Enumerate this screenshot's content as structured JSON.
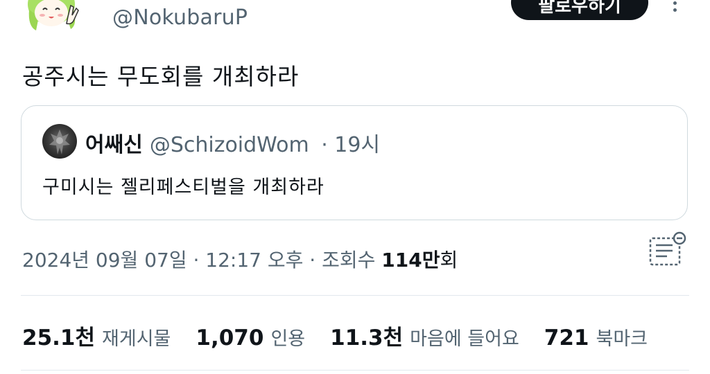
{
  "header": {
    "handle": "@NokubaruP",
    "follow_label": "팔로우하기"
  },
  "tweet": {
    "text": "공주시는 무도회를 개최하라"
  },
  "quote": {
    "name": "어쌔신",
    "handle": "@SchizoidWom",
    "time": "· 19시",
    "text": "구미시는 젤리페스티벌을 개최하라"
  },
  "meta": {
    "datetime": "2024년 09월 07일 · 12:17 오후 · 조회수 ",
    "views_number": "114만",
    "views_unit": "회"
  },
  "stats": [
    {
      "value": "25.1천",
      "label": "재게시물"
    },
    {
      "value": "1,070",
      "label": "인용"
    },
    {
      "value": "11.3천",
      "label": "마음에 들어요"
    },
    {
      "value": "721",
      "label": "북마크"
    }
  ],
  "colors": {
    "text_primary": "#0f1419",
    "text_secondary": "#536471",
    "border": "#cfd9de",
    "avatar_green": "#a8e063"
  },
  "icons": {
    "more": "more-vertical-icon",
    "community_note": "community-note-icon"
  }
}
